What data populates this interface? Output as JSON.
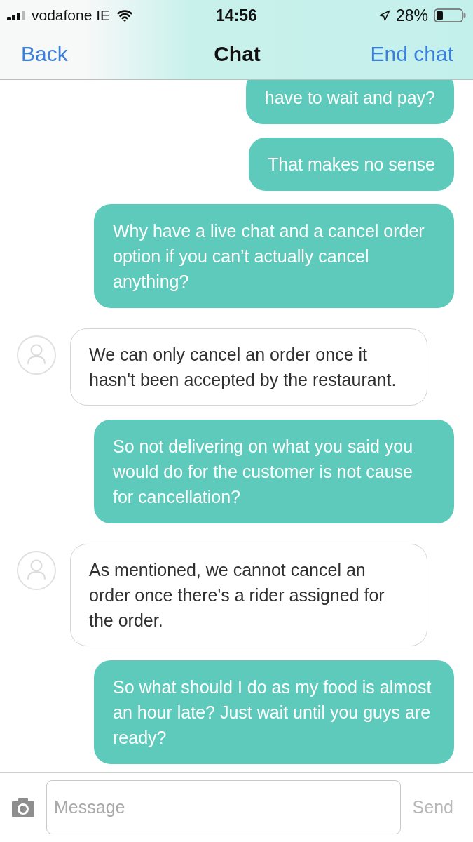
{
  "status_bar": {
    "carrier": "vodafone IE",
    "time": "14:56",
    "battery": "28%"
  },
  "nav_bar": {
    "back": "Back",
    "title": "Chat",
    "end_chat": "End chat"
  },
  "messages": [
    {
      "kind": "sent",
      "text": "have to wait and pay?"
    },
    {
      "kind": "sent",
      "text": "That makes no sense"
    },
    {
      "kind": "sent",
      "text": "Why have a live chat and a cancel order option if you can’t actually cancel anything?"
    },
    {
      "kind": "received",
      "text": "We can only cancel an order once it hasn't been accepted by the restaurant."
    },
    {
      "kind": "sent",
      "text": "So not delivering on what you said you would do for the customer is not cause for cancellation?"
    },
    {
      "kind": "received",
      "text": "As mentioned, we cannot cancel an order once there's a rider assigned for the order."
    },
    {
      "kind": "sent",
      "text": "So what should I do as my food is almost an hour late? Just wait until you guys are ready?"
    }
  ],
  "composer": {
    "placeholder": "Message",
    "send": {
      "label": "Send",
      "disabled": true
    }
  }
}
